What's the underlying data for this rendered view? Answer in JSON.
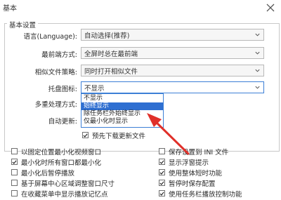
{
  "window": {
    "title": "基本"
  },
  "group": {
    "title": "基本设置"
  },
  "settings": [
    {
      "label": "语言(Language):",
      "value": "自动选择(推荐)"
    },
    {
      "label": "最前端方式:",
      "value": "全屏时总在最前端"
    },
    {
      "label": "相似文件策略:",
      "value": "同时打开相似文件"
    },
    {
      "label": "托盘图标:",
      "value": "不显示"
    },
    {
      "label": "多重处理方式:",
      "value": ""
    },
    {
      "label": "自动更新:",
      "value": ""
    }
  ],
  "dropdown": {
    "options": [
      "不显示",
      "始终显示",
      "除任务栏外始终显示",
      "仅最小化时显示"
    ],
    "selected_index": 1
  },
  "predownload": {
    "label": "预先下载更新文件",
    "checked": true
  },
  "options_left": [
    {
      "label": "以固定位置最小化视频窗口",
      "checked": false
    },
    {
      "label": "最小化时所有窗口都最小化",
      "checked": true
    },
    {
      "label": "最小化后暂停播放",
      "checked": false
    },
    {
      "label": "基于屏幕中心区域调整窗口尺寸",
      "checked": false
    },
    {
      "label": "在收藏菜单中显示播放记忆点",
      "checked": false
    }
  ],
  "options_right": [
    {
      "label": "保存设置到 INI 文件",
      "checked": false
    },
    {
      "label": "显示浮窗提示",
      "checked": true
    },
    {
      "label": "使用整体短时功能",
      "checked": true
    },
    {
      "label": "暂停时保存配置",
      "checked": true
    },
    {
      "label": "使用任务栏播放控制功能",
      "checked": true
    }
  ],
  "colors": {
    "accent": "#2f6fd1",
    "arrow": "#e0302a"
  },
  "icons": {
    "close": "close-icon",
    "dropdown": "chevron-down-icon",
    "check": "check-icon"
  }
}
